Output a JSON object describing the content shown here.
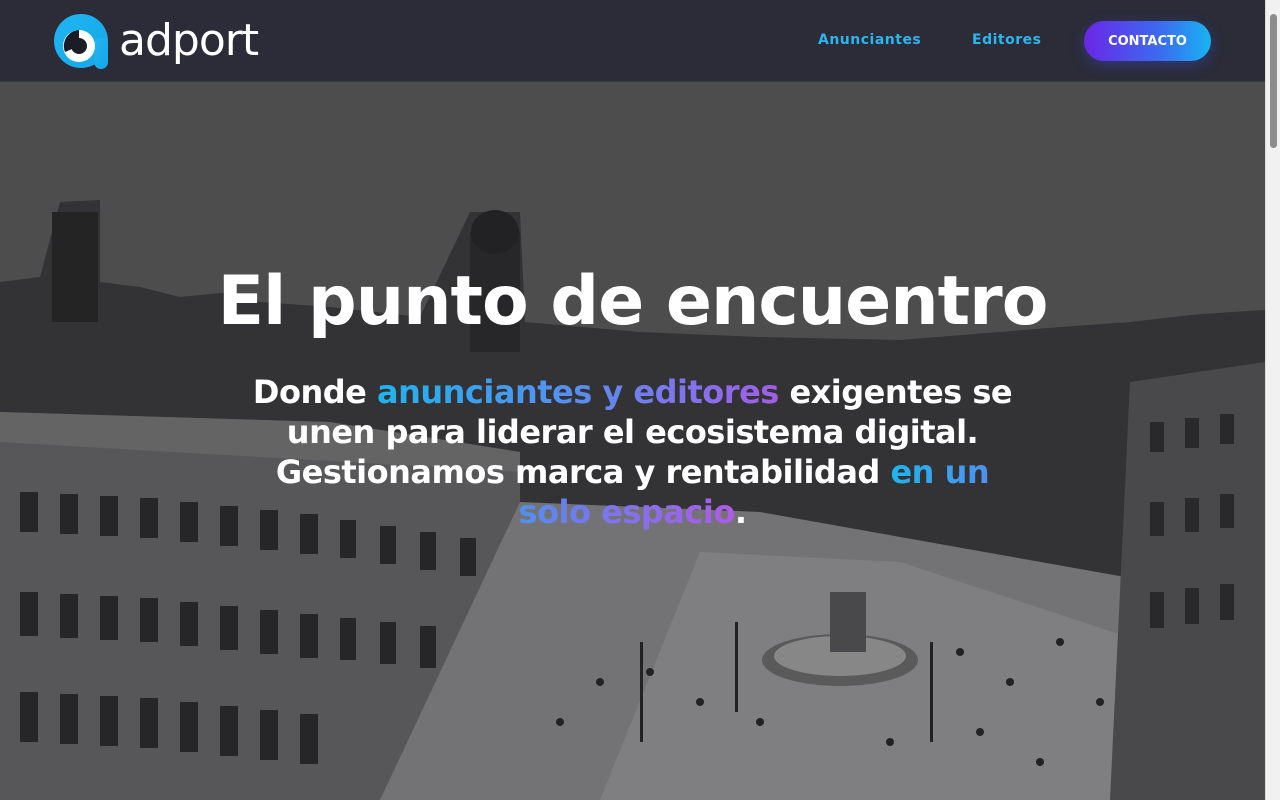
{
  "brand": {
    "name": "adport",
    "logo_icon": "adport-logo-icon"
  },
  "nav": {
    "links": [
      {
        "label": "Anunciantes"
      },
      {
        "label": "Editores"
      }
    ],
    "cta_label": "CONTACTO"
  },
  "hero": {
    "title": "El punto de encuentro",
    "subtitle_parts": {
      "p1": "Donde ",
      "p2": "anunciantes y editores",
      "p3": " exigentes se unen para liderar el ecosistema digital. Gestionamos marca y rentabilidad ",
      "p4": "en un solo espacio",
      "p5": "."
    },
    "background": "black-and-white aerial photo of Puerta del Sol square"
  },
  "colors": {
    "header_bg": "#2b2c38",
    "nav_link": "#2bb6ef",
    "cta_gradient_start": "#6a27e6",
    "cta_gradient_end": "#17b4f2",
    "highlight_start": "#1fb4ef",
    "highlight_end": "#a35de8"
  }
}
